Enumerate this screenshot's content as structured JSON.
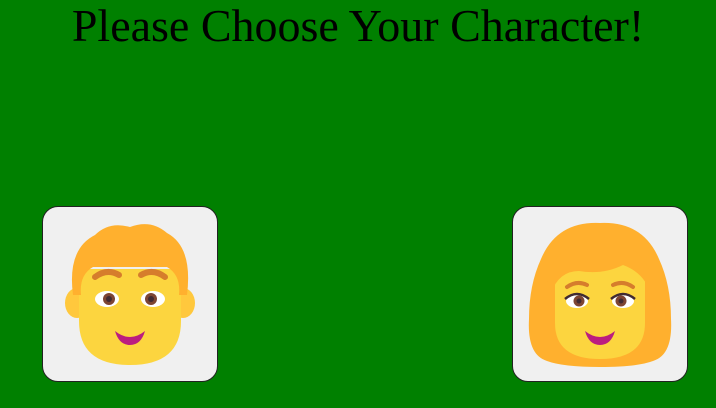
{
  "page": {
    "title": "Please Choose Your Character!",
    "background_color": "#008000"
  },
  "characters": [
    {
      "id": "male",
      "icon": "man-face-icon"
    },
    {
      "id": "female",
      "icon": "woman-face-icon"
    }
  ]
}
